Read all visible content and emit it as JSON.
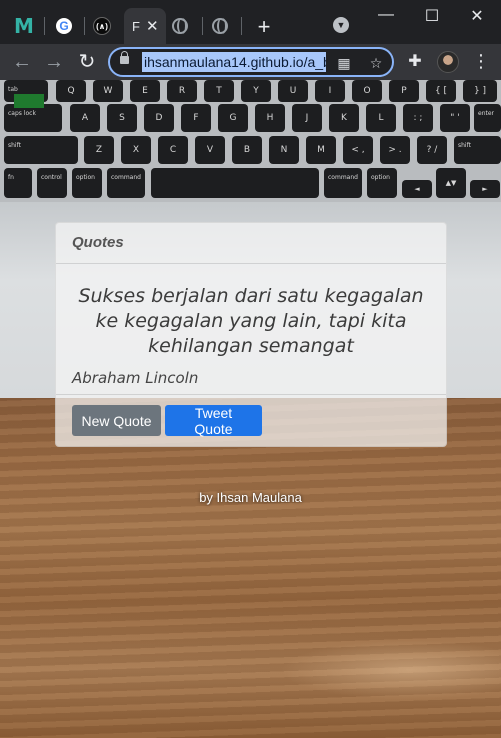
{
  "browser": {
    "tabs": [
      {
        "favicon": "medium-m-icon",
        "label": ""
      },
      {
        "favicon": "google-g-icon",
        "label": ""
      },
      {
        "favicon": "freecodecamp-icon",
        "label": ""
      },
      {
        "favicon": "page-icon",
        "label": "F",
        "active": true
      },
      {
        "favicon": "globe-icon",
        "label": ""
      },
      {
        "favicon": "globe-icon",
        "label": ""
      }
    ],
    "url": "ihsanmaulana14.github.io/a_b",
    "colors": {
      "frame": "#202124",
      "toolbar": "#35363a",
      "omnibox_border": "#8ab4f8",
      "url_highlight": "#a8c7fa"
    }
  },
  "quote_card": {
    "header": "Quotes",
    "quote_text": "Sukses berjalan dari satu kegagalan ke kegagalan yang lain, tapi kita kehilangan semangat",
    "author": "Abraham Lincoln",
    "new_quote_label": "New Quote",
    "tweet_quote_label": "Tweet Quote",
    "colors": {
      "new_quote_button": "#6c757d",
      "tweet_button": "#1e74e8"
    }
  },
  "footer": {
    "byline": "by Ihsan Maulana"
  },
  "keyboard": {
    "row1": [
      "tab",
      "Q",
      "W",
      "E",
      "R",
      "T",
      "Y",
      "U",
      "I",
      "O",
      "P",
      "{ [",
      "} ]",
      "| \\"
    ],
    "row2": [
      "caps lock",
      "A",
      "S",
      "D",
      "F",
      "G",
      "H",
      "J",
      "K",
      "L",
      ": ;",
      "\" '",
      "enter"
    ],
    "row3": [
      "shift",
      "Z",
      "X",
      "C",
      "V",
      "B",
      "N",
      "M",
      "< ,",
      "> .",
      "? /",
      "shift"
    ],
    "row4": [
      "fn",
      "control",
      "option",
      "command",
      "",
      "command",
      "option",
      "◄",
      "▲▼",
      "►"
    ]
  }
}
